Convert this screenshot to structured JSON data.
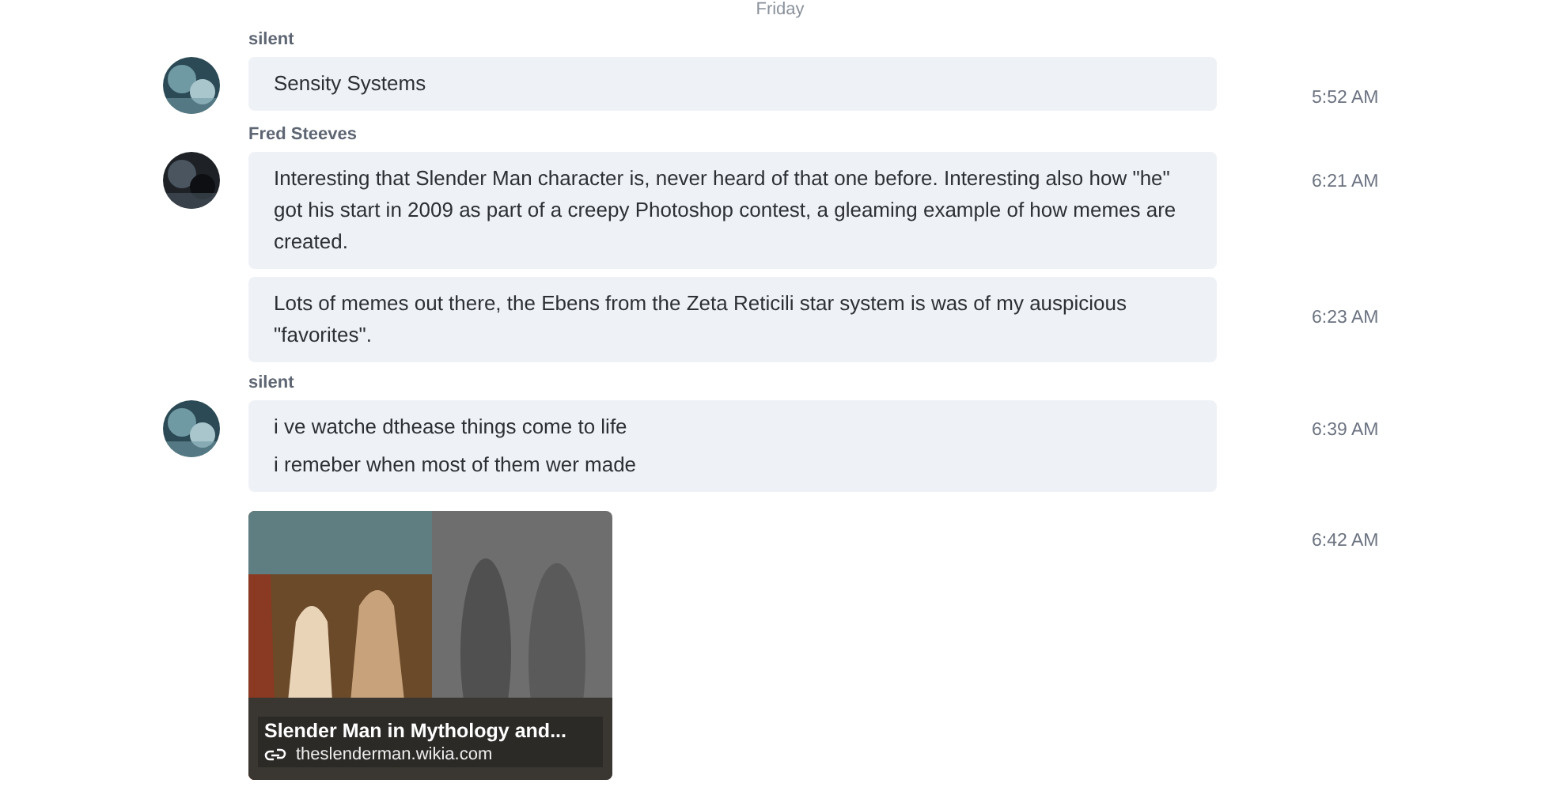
{
  "date_divider": "Friday",
  "groups": [
    {
      "author": "silent",
      "messages": [
        {
          "kind": "text",
          "paragraphs": [
            "Sensity Systems"
          ],
          "time": "5:52 AM"
        }
      ]
    },
    {
      "author": "Fred Steeves",
      "messages": [
        {
          "kind": "text",
          "paragraphs": [
            "Interesting that Slender Man character is, never heard of that one before. Interesting also how \"he\" got his start in 2009 as part of a creepy Photoshop contest, a gleaming example of how memes are created."
          ],
          "time": "6:21 AM"
        },
        {
          "kind": "text",
          "paragraphs": [
            "Lots of memes out there, the Ebens from the Zeta Reticili star system is was of my auspicious \"favorites\"."
          ],
          "time": "6:23 AM"
        }
      ]
    },
    {
      "author": "silent",
      "messages": [
        {
          "kind": "text",
          "paragraphs": [
            "i ve watche dthease things come to life",
            "i remeber when most of them wer made"
          ],
          "time": "6:39 AM"
        },
        {
          "kind": "link",
          "title": "Slender Man in Mythology and...",
          "domain": "theslenderman.wikia.com",
          "time": "6:42 AM"
        }
      ]
    }
  ]
}
